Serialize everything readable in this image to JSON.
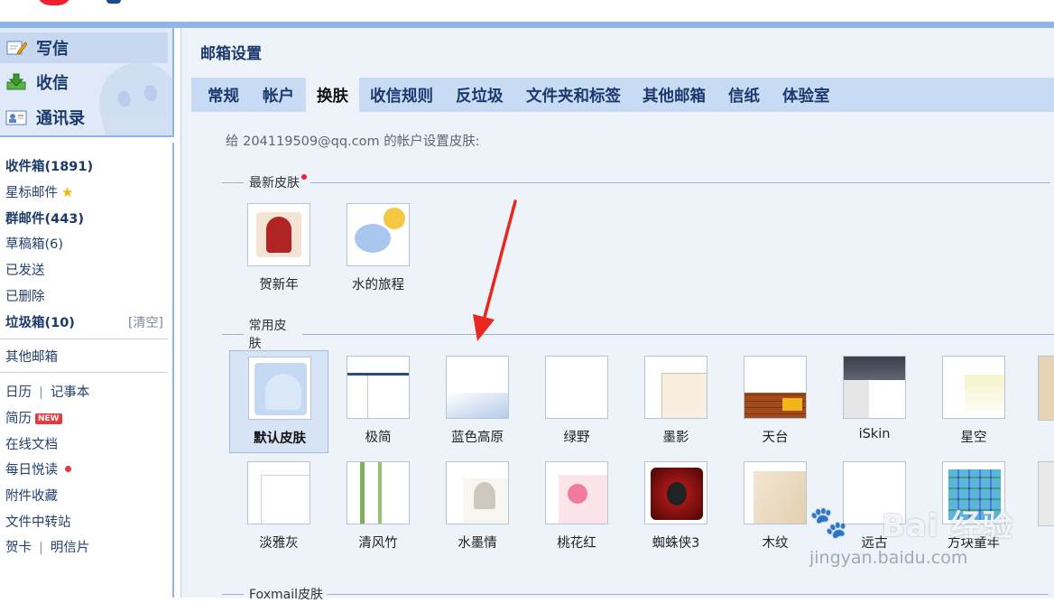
{
  "nav": {
    "write": "写信",
    "receive": "收信",
    "contacts": "通讯录"
  },
  "folders": {
    "inbox": "收件箱(1891)",
    "starred": "星标邮件",
    "group": "群邮件(443)",
    "drafts": "草稿箱(6)",
    "sent": "已发送",
    "deleted": "已删除",
    "spam": "垃圾箱(10)",
    "spam_clear": "[清空]",
    "other_mailbox": "其他邮箱"
  },
  "tools": {
    "calendar": "日历",
    "notepad": "记事本",
    "resume": "简历",
    "resume_badge": "NEW",
    "online_docs": "在线文档",
    "daily_read": "每日悦读",
    "attachments": "附件收藏",
    "file_transfer": "文件中转站",
    "cards": "贺卡",
    "postcards": "明信片",
    "separator": "|"
  },
  "settings": {
    "title": "邮箱设置",
    "tabs": [
      "常规",
      "帐户",
      "换肤",
      "收信规则",
      "反垃圾",
      "文件夹和标签",
      "其他邮箱",
      "信纸",
      "体验室"
    ],
    "active_tab": "换肤",
    "account_line": "给 204119509@qq.com 的帐户设置皮肤:"
  },
  "sections": {
    "latest": "最新皮肤",
    "common": "常用皮肤",
    "foxmail": "Foxmail皮肤"
  },
  "latest_skins": [
    "贺新年",
    "水的旅程"
  ],
  "common_skins_row1": [
    "默认皮肤",
    "极简",
    "蓝色高原",
    "绿野",
    "墨影",
    "天台",
    "iSkin",
    "星空"
  ],
  "common_skins_row2": [
    "淡雅灰",
    "清风竹",
    "水墨情",
    "桃花红",
    "蜘蛛侠3",
    "木纹",
    "远古",
    "方块童年"
  ],
  "selected_skin": "默认皮肤",
  "colors": {
    "accent_blue": "#8fb5e6",
    "tab_bar": "#c7dbf4",
    "panel_bg": "#eef3fa",
    "arrow_red": "#e8271e"
  },
  "watermark": {
    "main": "Bai 经验",
    "sub": "jingyan.baidu.com"
  }
}
